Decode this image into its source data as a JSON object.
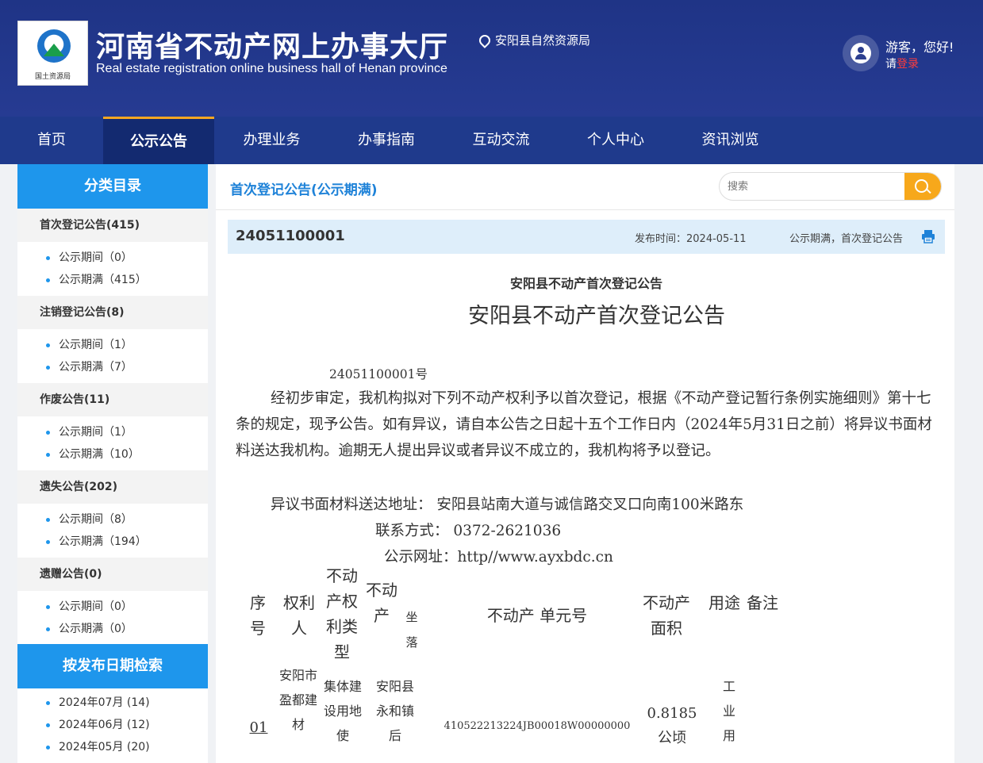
{
  "header": {
    "logo_text": "国土资源局",
    "title": "河南省不动产网上办事大厅",
    "subtitle": "Real estate registration online business hall of Henan province",
    "location": "安阳县自然资源局",
    "greeting": "游客，您好!",
    "login_prefix": "请",
    "login_link": "登录"
  },
  "nav": [
    {
      "label": "首页",
      "active": false
    },
    {
      "label": "公示公告",
      "active": true
    },
    {
      "label": "办理业务",
      "active": false
    },
    {
      "label": "办事指南",
      "active": false
    },
    {
      "label": "互动交流",
      "active": false
    },
    {
      "label": "个人中心",
      "active": false
    },
    {
      "label": "资讯浏览",
      "active": false
    }
  ],
  "sidebar": {
    "title": "分类目录",
    "categories": [
      {
        "title": "首次登记公告(415)",
        "items": [
          "公示期间（0）",
          "公示期满（415）"
        ]
      },
      {
        "title": "注销登记公告(8)",
        "items": [
          "公示期间（1）",
          "公示期满（7）"
        ]
      },
      {
        "title": "作废公告(11)",
        "items": [
          "公示期间（1）",
          "公示期满（10）"
        ]
      },
      {
        "title": "遗失公告(202)",
        "items": [
          "公示期间（8）",
          "公示期满（194）"
        ]
      },
      {
        "title": "遗赠公告(0)",
        "items": [
          "公示期间（0）",
          "公示期满（0）"
        ]
      }
    ],
    "date_title": "按发布日期检索",
    "dates": [
      "2024年07月 (14)",
      "2024年06月 (12)",
      "2024年05月 (20)"
    ]
  },
  "main": {
    "section_title": "首次登记公告(公示期满)",
    "search_placeholder": "搜索",
    "notice_no": "24051100001",
    "pub_time": "发布时间：2024-05-11",
    "notice_tag": "公示期满，首次登记公告",
    "doc_small_title": "安阳县不动产首次登记公告",
    "doc_title": "安阳县不动产首次登记公告",
    "doc_no": "24051100001号",
    "doc_body": "经初步审定，我机构拟对下列不动产权利予以首次登记，根据《不动产登记暂行条例实施细则》第十七条的规定，现予公告。如有异议，请自本公告之日起十五个工作日内（2024年5月31日之前）将异议书面材料送达我机构。逾期无人提出异议或者异议不成立的，我机构将予以登记。",
    "doc_addr": "异议书面材料送达地址： 安阳县站南大道与诚信路交叉口向南100米路东",
    "doc_tel": "联系方式： 0372-2621036",
    "doc_web": "公示网址：http//www.ayxbdc.cn",
    "table": {
      "headers": [
        "序号",
        "权利人",
        "不动产权利类型",
        "不动产",
        "坐落",
        "不动产 单元号",
        "不动产面积",
        "用途",
        "备注"
      ],
      "row": {
        "seq": "01",
        "owner": "安阳市盈都建材",
        "right_type": "集体建设用地使",
        "location": "安阳县永和镇后",
        "unit_no": "410522213224JB00018W00000000",
        "area": "0.8185公顷",
        "use": "工业用"
      }
    }
  }
}
